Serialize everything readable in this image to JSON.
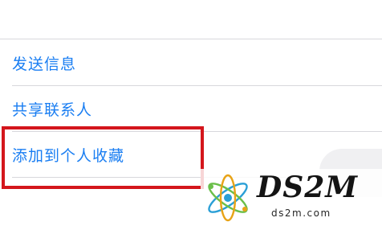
{
  "menu": {
    "items": [
      {
        "label": "发送信息"
      },
      {
        "label": "共享联系人"
      },
      {
        "label": "添加到个人收藏"
      }
    ]
  },
  "colors": {
    "accent_text": "#1a7ef2",
    "highlight_border": "#d4161c",
    "divider": "#d8d8dc"
  },
  "watermark": {
    "title": "DS2M",
    "url": "ds2m.com"
  }
}
